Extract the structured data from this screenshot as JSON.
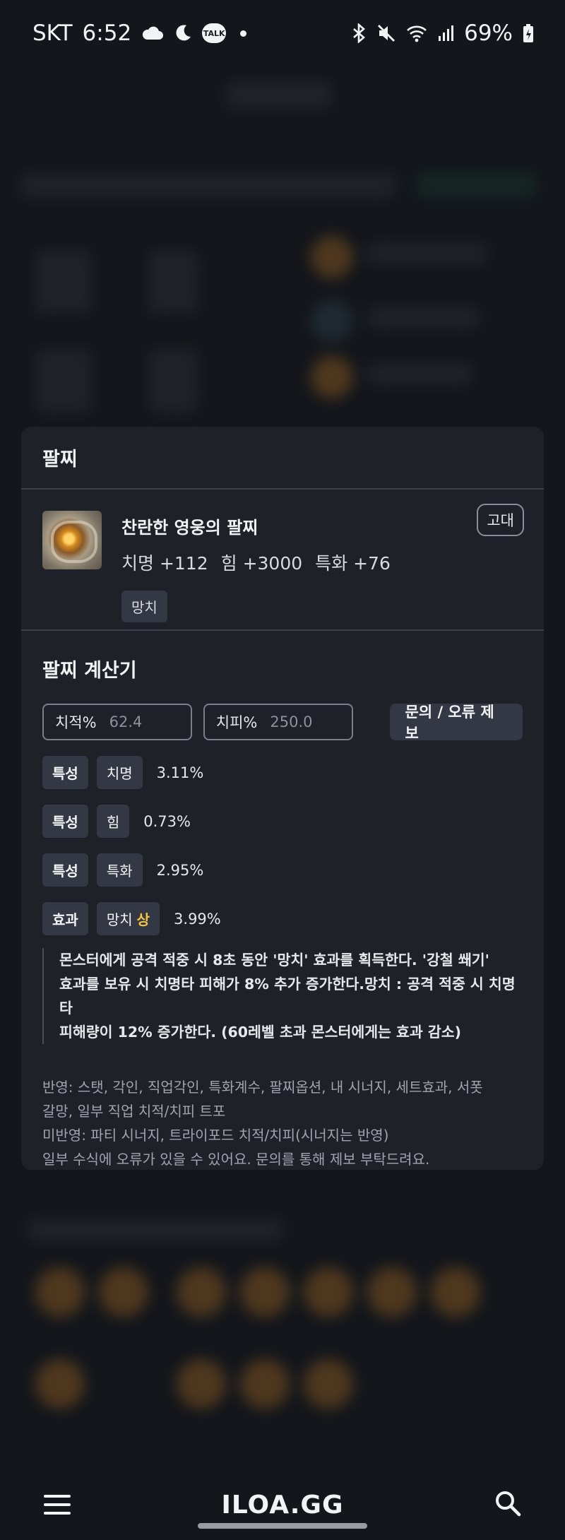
{
  "status_bar": {
    "carrier": "SKT",
    "time": "6:52",
    "talk_label": "TALK",
    "battery": "69%"
  },
  "modal": {
    "title": "팔찌",
    "item": {
      "name": "찬란한 영웅의 팔찌",
      "stats": [
        "치명 +112",
        "힘 +3000",
        "특화 +76"
      ],
      "tag": "망치",
      "grade": "고대"
    },
    "calculator": {
      "title": "팔찌 계산기",
      "crit_rate": {
        "label": "치적%",
        "value": "62.4"
      },
      "crit_damage": {
        "label": "치피%",
        "value": "250.0"
      },
      "report_button": "문의 / 오류 제보",
      "results": [
        {
          "type": "특성",
          "name": "치명",
          "value": "3.11%"
        },
        {
          "type": "특성",
          "name": "힘",
          "value": "0.73%"
        },
        {
          "type": "특성",
          "name": "특화",
          "value": "2.95%"
        },
        {
          "type": "효과",
          "name": "망치",
          "grade": "상",
          "value": "3.99%"
        }
      ],
      "effect_description": [
        "몬스터에게 공격 적중 시 8초 동안 '망치' 효과를 획득한다. '강철 쐐기'",
        "효과를 보유 시 치명타 피해가 8% 추가 증가한다.망치 : 공격 적중 시 치명타",
        "피해량이 12% 증가한다. (60레벨 초과 몬스터에게는 효과 감소)"
      ],
      "notes": [
        "반영: 스탯, 각인, 직업각인, 특화계수, 팔찌옵션, 내 시너지, 세트효과, 서폿",
        "갈망, 일부 직업 치적/치피 트포",
        "미반영: 파티 시너지, 트라이포드 치적/치피(시너지는 반영)",
        "일부 수식에 오류가 있을 수 있어요. 문의를 통해 제보 부탁드려요."
      ]
    }
  },
  "bottom_bar": {
    "logo": "ILOA.GG"
  }
}
